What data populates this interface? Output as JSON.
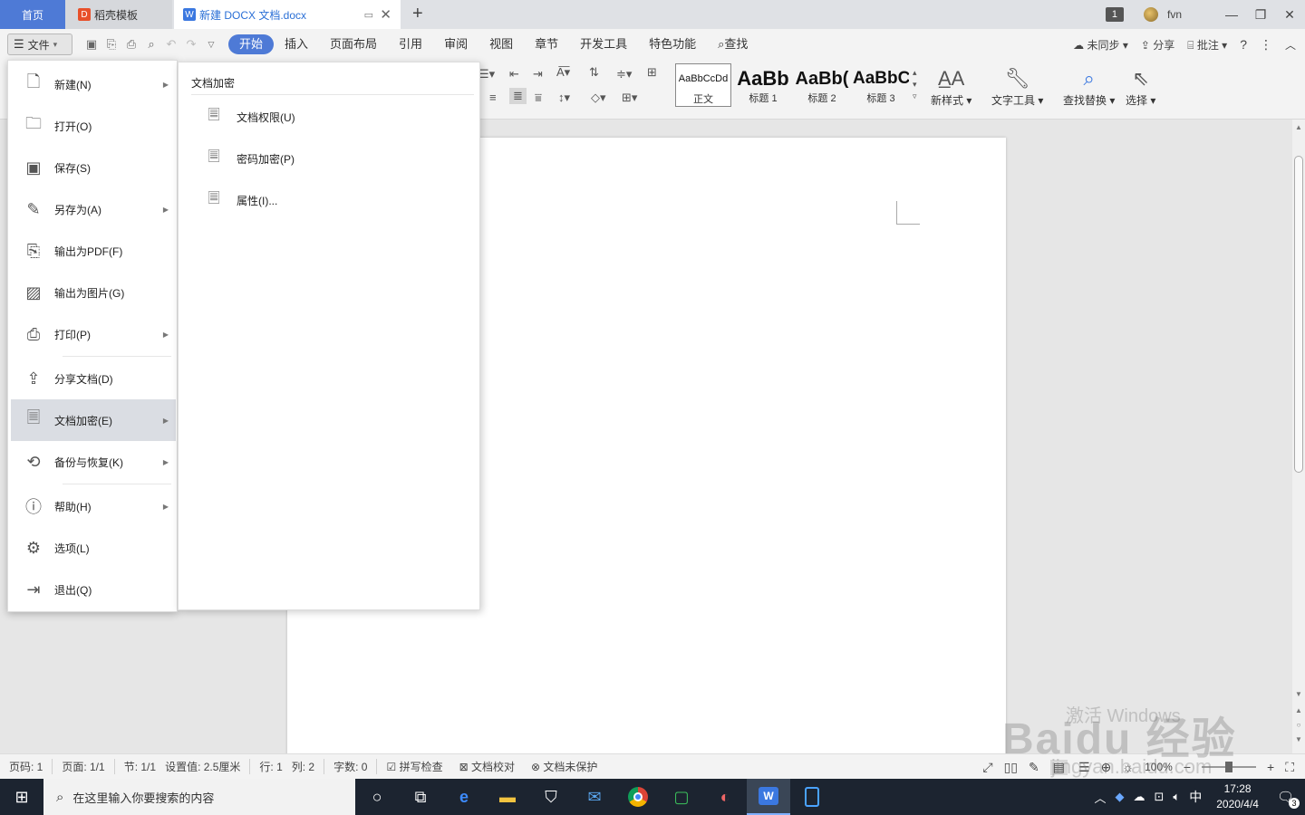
{
  "tabs": {
    "home": "首页",
    "template": "稻壳模板",
    "document": "新建 DOCX 文档.docx",
    "window_count": "1",
    "user": "fvn"
  },
  "menubar": {
    "file": "文件",
    "tabs": [
      "开始",
      "插入",
      "页面布局",
      "引用",
      "审阅",
      "视图",
      "章节",
      "开发工具",
      "特色功能"
    ],
    "search": "查找",
    "sync": "未同步",
    "share": "分享",
    "comment": "批注"
  },
  "ribbon": {
    "styles": [
      {
        "sample": "AaBbCcDd",
        "label": "正文"
      },
      {
        "sample": "AaBb",
        "label": "标题 1"
      },
      {
        "sample": "AaBb(",
        "label": "标题 2"
      },
      {
        "sample": "AaBbC(",
        "label": "标题 3"
      }
    ],
    "new_style": "新样式",
    "text_tools": "文字工具",
    "find_replace": "查找替换",
    "select": "选择"
  },
  "file_menu": {
    "items": [
      {
        "label": "新建(N)",
        "icon": "new-doc-icon"
      },
      {
        "label": "打开(O)",
        "icon": "folder-icon"
      },
      {
        "label": "保存(S)",
        "icon": "save-icon"
      },
      {
        "label": "另存为(A)",
        "icon": "save-as-icon"
      },
      {
        "label": "输出为PDF(F)",
        "icon": "pdf-icon"
      },
      {
        "label": "输出为图片(G)",
        "icon": "image-icon"
      },
      {
        "label": "打印(P)",
        "icon": "printer-icon"
      },
      {
        "label": "分享文档(D)",
        "icon": "share-icon"
      },
      {
        "label": "文档加密(E)",
        "icon": "lock-doc-icon"
      },
      {
        "label": "备份与恢复(K)",
        "icon": "backup-icon"
      },
      {
        "label": "帮助(H)",
        "icon": "help-icon"
      },
      {
        "label": "选项(L)",
        "icon": "gear-icon"
      },
      {
        "label": "退出(Q)",
        "icon": "exit-icon"
      }
    ]
  },
  "submenu": {
    "title": "文档加密",
    "items": [
      "文档权限(U)",
      "密码加密(P)",
      "属性(I)..."
    ]
  },
  "statusbar": {
    "page_num": "页码: 1",
    "pages": "页面: 1/1",
    "section": "节: 1/1",
    "setting": "设置值: 2.5厘米",
    "row": "行: 1",
    "col": "列: 2",
    "words": "字数: 0",
    "spell": "拼写检查",
    "proof": "文档校对",
    "protect": "文档未保护",
    "zoom": "100%"
  },
  "watermark": {
    "line1": "激活 Windows",
    "line2": "Baidu 经验",
    "line3": "jingyan.baidu.com"
  },
  "taskbar": {
    "search_placeholder": "在这里输入你要搜索的内容",
    "time": "17:28",
    "date": "2020/4/4",
    "ime": "中",
    "notifications": "3"
  },
  "colors": {
    "accent": "#4e7ad6",
    "doc_tab_text": "#2a6fd6",
    "taskbar": "#1c2430"
  }
}
